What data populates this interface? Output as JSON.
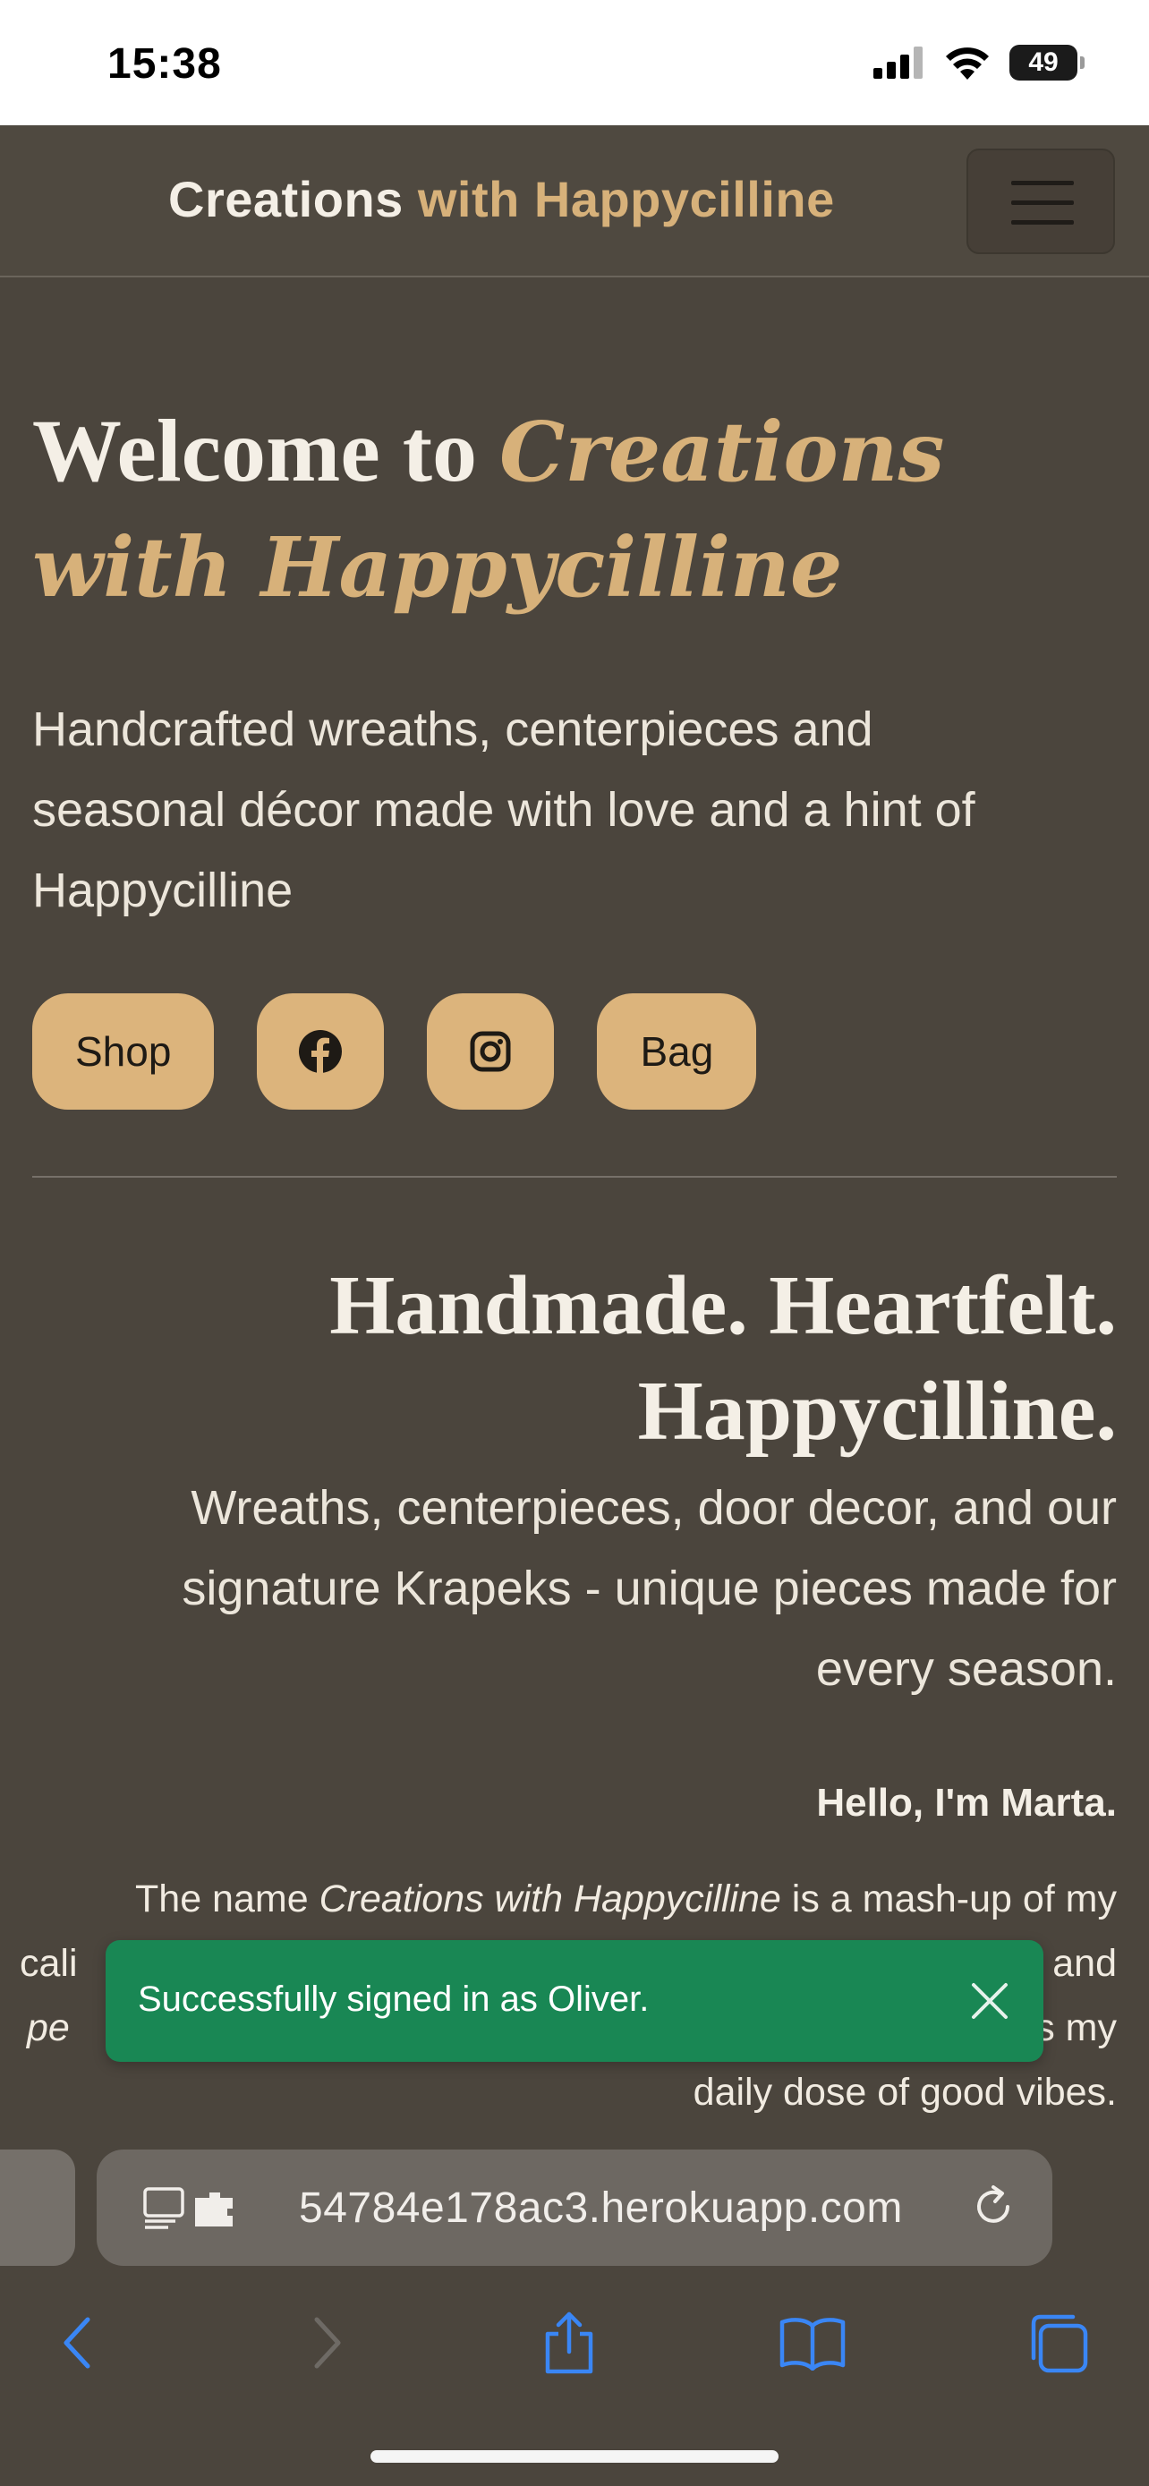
{
  "status_bar": {
    "time": "15:38",
    "battery": "49"
  },
  "navbar": {
    "brand_main": "Creations",
    "brand_accent": "with Happycilline",
    "menu_icon": "hamburger-icon"
  },
  "hero": {
    "title_plain": "Welcome to",
    "title_script": "Creations with Happycilline",
    "description": "Handcrafted wreaths, centerpieces and seasonal décor made with love and a hint of Happycilline",
    "buttons": {
      "shop": "Shop",
      "facebook_icon": "facebook-icon",
      "instagram_icon": "instagram-icon",
      "bag": "Bag"
    }
  },
  "about": {
    "title_line1": "Handmade. Heartfelt.",
    "title_line2": "Happycilline.",
    "subtitle": "Wreaths, centerpieces, door decor, and our signature Krapeks - unique pieces made for every season.",
    "hello": "Hello, I'm Marta.",
    "bio_prefix": "The name",
    "bio_emphasis": "Creations with Happycilline",
    "bio_suffix": "is a mash-up of my",
    "bio_line2_start": "cali",
    "bio_line2_end": "and",
    "bio_line3_start": "pe",
    "bio_line3_end": "s my",
    "bio_last": "daily dose of good vibes."
  },
  "toast": {
    "message": "Successfully signed in as Oliver.",
    "close_icon": "close-icon",
    "color": "#198754"
  },
  "browser": {
    "url": "54784e178ac3.herokuapp.com",
    "toolbar_icons": [
      "back-icon",
      "forward-icon",
      "share-icon",
      "bookmarks-icon",
      "tabs-icon"
    ]
  },
  "colors": {
    "background": "#4b453d",
    "accent": "#d7b17a",
    "button": "#dcb47c",
    "text": "#f4efe6"
  }
}
